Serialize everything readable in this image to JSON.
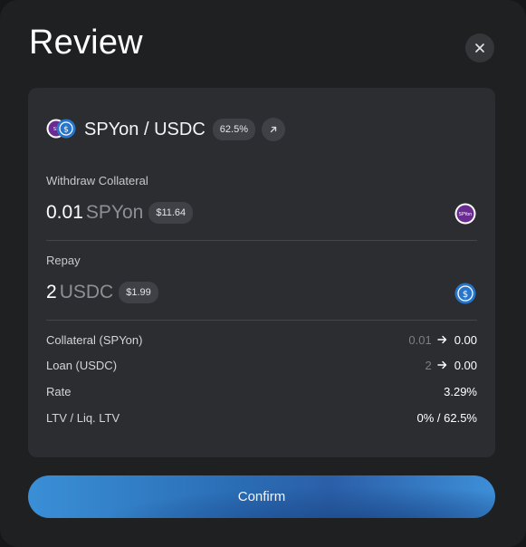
{
  "dialog": {
    "title": "Review",
    "close_icon": "close-icon"
  },
  "pair": {
    "name": "SPYon / USDC",
    "ltv_badge": "62.5%",
    "icons": [
      "spyon-token-icon",
      "usdc-token-icon"
    ],
    "external_link_icon": "arrow-up-right-icon"
  },
  "withdraw": {
    "label": "Withdraw Collateral",
    "amount": "0.01",
    "symbol": "SPYon",
    "usd_value": "$11.64",
    "token_icon_text": "SPYon"
  },
  "repay": {
    "label": "Repay",
    "amount": "2",
    "symbol": "USDC",
    "usd_value": "$1.99"
  },
  "summary": {
    "collateral": {
      "label": "Collateral (SPYon)",
      "from": "0.01",
      "to": "0.00"
    },
    "loan": {
      "label": "Loan (USDC)",
      "from": "2",
      "to": "0.00"
    },
    "rate": {
      "label": "Rate",
      "value": "3.29%"
    },
    "ltv": {
      "label": "LTV / Liq. LTV",
      "value": "0% / 62.5%"
    }
  },
  "confirm_label": "Confirm",
  "colors": {
    "background": "#1f2022",
    "card": "#2b2d31",
    "spyon_purple": "#6a2c91",
    "usdc_blue": "#2775ca",
    "button_blue": "#2f78c4"
  }
}
